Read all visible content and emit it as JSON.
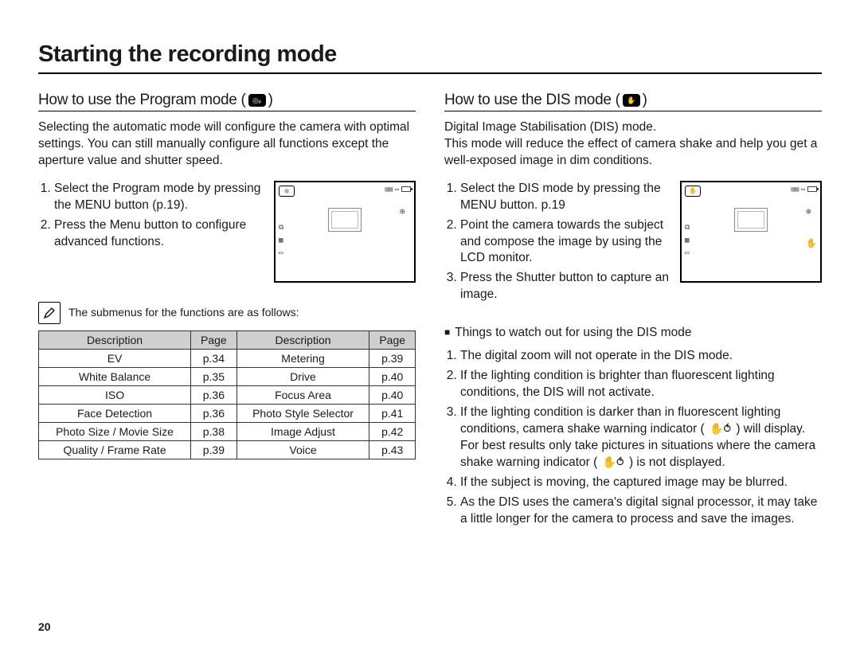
{
  "page_number": "20",
  "main_title": "Starting the recording mode",
  "program": {
    "heading_prefix": "How to use the Program mode (",
    "heading_suffix": " )",
    "badge_glyph": "◎ₚ",
    "intro": "Selecting the automatic mode will configure the camera with optimal settings. You can still manually configure all functions except the aperture value and shutter speed.",
    "step1": "Select the Program mode by pressing the MENU button (p.19).",
    "step2": "Press the Menu button to configure advanced functions.",
    "note_text": "The submenus for the functions are as follows:",
    "table_headers": {
      "desc": "Description",
      "page": "Page"
    },
    "rows": [
      {
        "d1": "EV",
        "p1": "p.34",
        "d2": "Metering",
        "p2": "p.39"
      },
      {
        "d1": "White Balance",
        "p1": "p.35",
        "d2": "Drive",
        "p2": "p.40"
      },
      {
        "d1": "ISO",
        "p1": "p.36",
        "d2": "Focus Area",
        "p2": "p.40"
      },
      {
        "d1": "Face Detection",
        "p1": "p.36",
        "d2": "Photo Style Selector",
        "p2": "p.41"
      },
      {
        "d1": "Photo Size / Movie Size",
        "p1": "p.38",
        "d2": "Image Adjust",
        "p2": "p.42"
      },
      {
        "d1": "Quality / Frame Rate",
        "p1": "p.39",
        "d2": "Voice",
        "p2": "p.43"
      }
    ]
  },
  "dis": {
    "heading_prefix": "How to use the DIS mode (",
    "heading_suffix": " )",
    "badge_glyph": "✋",
    "intro": "Digital Image Stabilisation (DIS) mode.\nThis mode will reduce the effect of camera shake and help you get a well-exposed image in dim conditions.",
    "step1": "Select the DIS mode by pressing the MENU button. p.19",
    "step2": "Point the camera towards the subject and compose the image by using the LCD monitor.",
    "step3": "Press the Shutter button to capture an image.",
    "watch_heading": "Things to watch out for using the DIS mode",
    "note1": "The digital zoom will not operate in the DIS mode.",
    "note2a": "If the lighting condition is brighter than fluorescent lighting conditions, the DIS will not activate.",
    "note3a": "If the lighting condition is darker than in fluorescent lighting conditions, camera shake warning indicator (",
    "note3b": ") will display. For best results only take pictures in situations where the camera shake warning indicator (",
    "note3c": ") is not displayed.",
    "note4": "If the subject is moving, the captured image may be blurred.",
    "note5": "As the DIS uses the camera's digital signal processor, it may take a little longer for the camera to process and save the images.",
    "hand_glyph": "✋⥀"
  },
  "lcd_left_icons": [
    "⧉",
    "▦",
    "▭"
  ]
}
